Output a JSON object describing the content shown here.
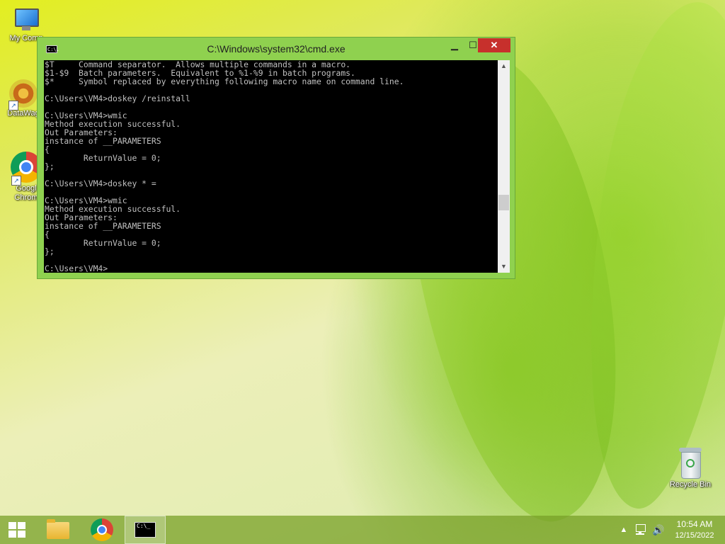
{
  "desktop": {
    "icons": [
      {
        "label": "My Comp"
      },
      {
        "label": "DataWag"
      },
      {
        "label": "Googl"
      },
      {
        "label": "Chrom"
      },
      {
        "label": "Recycle Bin"
      }
    ]
  },
  "cmd_window": {
    "title": "C:\\Windows\\system32\\cmd.exe",
    "icon_glyph": "C:\\.",
    "buttons": {
      "minimize": "▁",
      "maximize": "☐",
      "close": "✕"
    },
    "lines": [
      "$T     Command separator.  Allows multiple commands in a macro.",
      "$1-$9  Batch parameters.  Equivalent to %1-%9 in batch programs.",
      "$*     Symbol replaced by everything following macro name on command line.",
      "",
      "C:\\Users\\VM4>doskey /reinstall",
      "",
      "C:\\Users\\VM4>wmic",
      "Method execution successful.",
      "Out Parameters:",
      "instance of __PARAMETERS",
      "{",
      "        ReturnValue = 0;",
      "};",
      "",
      "C:\\Users\\VM4>doskey * =",
      "",
      "C:\\Users\\VM4>wmic",
      "Method execution successful.",
      "Out Parameters:",
      "instance of __PARAMETERS",
      "{",
      "        ReturnValue = 0;",
      "};",
      "",
      "C:\\Users\\VM4>"
    ],
    "scrollbar": {
      "up": "▲",
      "down": "▼"
    }
  },
  "taskbar": {
    "cmd_glyph": "C:\\_",
    "tray": {
      "arrow": "▲",
      "volume": "🔊"
    },
    "clock": {
      "time": "10:54 AM",
      "date": "12/15/2022"
    }
  }
}
